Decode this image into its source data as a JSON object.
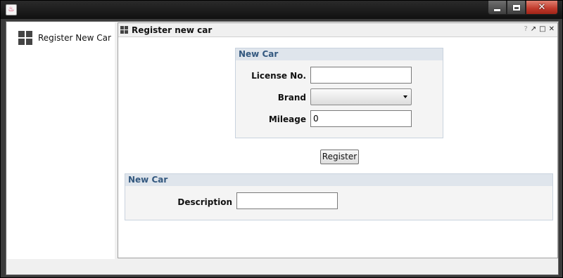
{
  "window": {
    "app_icon": "java-icon",
    "controls": {
      "minimize": "minimize-icon",
      "maximize": "maximize-icon",
      "close": "close-icon"
    }
  },
  "sidebar": {
    "items": [
      {
        "label": "Register New Car",
        "icon": "grid-icon"
      }
    ]
  },
  "panel": {
    "title": "Register new car",
    "header_tools": {
      "help": "?",
      "detach": "↗",
      "maximize": "□",
      "close": "✕"
    }
  },
  "form_car": {
    "group_title": "New Car",
    "license_label": "License No.",
    "license_value": "",
    "brand_label": "Brand",
    "brand_value": "",
    "mileage_label": "Mileage",
    "mileage_value": "0"
  },
  "register_button": "Register",
  "form_description": {
    "group_title": "New Car",
    "description_label": "Description",
    "description_value": ""
  },
  "colors": {
    "group_header_text": "#33587f",
    "group_header_bg": "#dfe5ec",
    "close_button": "#c0392b"
  }
}
